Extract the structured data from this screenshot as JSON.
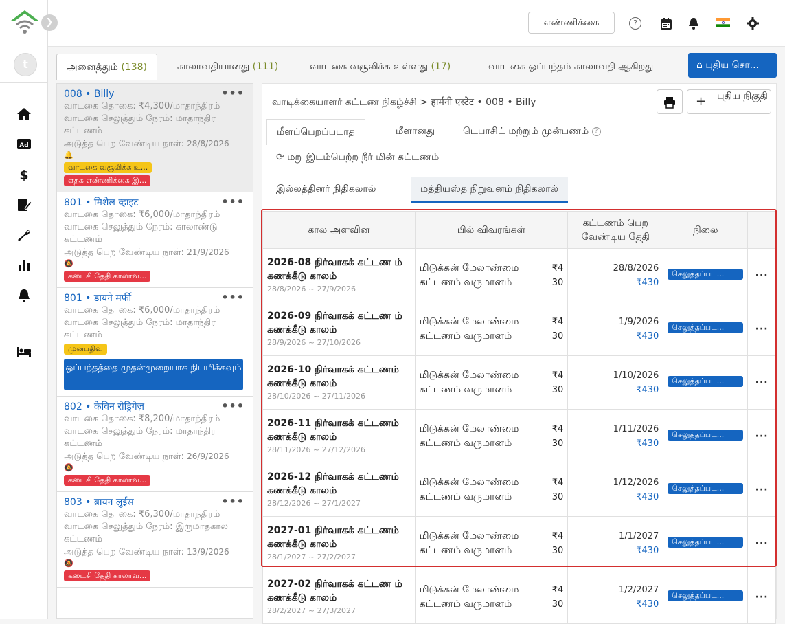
{
  "topbar": {
    "count_label": "எண்ணிக்கை",
    "help_glyph": "?"
  },
  "sidebar": {
    "avatar_initial": "t"
  },
  "tabs": [
    {
      "label": "அனைத்தும்",
      "count": "(138)"
    },
    {
      "label": "காலாவதியானது",
      "count": "(111)"
    },
    {
      "label": "வாடகை வசூலிக்க உள்ளது",
      "count": "(17)"
    },
    {
      "label": "வாடகை ஒப்பந்தம் காலாவதி ஆகிறது",
      "count": ""
    }
  ],
  "new_button": "புதிய சொ...",
  "tenants": [
    {
      "unit": "008",
      "name": "Billy",
      "rent": "வாடகை தொகை: ₹4,300/மாதாந்திரம்",
      "pay": "வாடகை செலுத்தும் நேரம்: மாதாந்திர கட்டணம்",
      "due_label": "அடுத்த பெற வேண்டிய நாள்:",
      "due": "28/8/2026",
      "badges": [
        {
          "text": "வாடகை வசூலிக்க உ...",
          "color": "yellow"
        },
        {
          "text": "ஏதக எண்ணிக்கை இ...",
          "color": "red"
        }
      ]
    },
    {
      "unit": "801",
      "name": "मिशेल व्हाइट",
      "rent": "வாடகை தொகை: ₹6,000/மாதாந்திரம்",
      "pay": "வாடகை செலுத்தும் நேரம்: காலாண்டு கட்டணம்",
      "due_label": "அடுத்த பெற வேண்டிய நாள்:",
      "due": "21/9/2026",
      "badges": [
        {
          "text": "கடைசி தேதி காலாவ...",
          "color": "red"
        }
      ]
    },
    {
      "unit": "801",
      "name": "डायने मर्फी",
      "rent": "வாடகை தொகை: ₹6,000/மாதாந்திரம்",
      "pay": "வாடகை செலுத்தும் நேரம்: மாதாந்திர கட்டணம்",
      "badges": [
        {
          "text": "முன்பதிவு",
          "color": "yellow"
        }
      ],
      "button": "ஒப்பந்தத்தை முதன்முறையாக நியமிக்கவும்"
    },
    {
      "unit": "802",
      "name": "केविन रोड्रिगेज़",
      "rent": "வாடகை தொகை: ₹8,200/மாதாந்திரம்",
      "pay": "வாடகை செலுத்தும் நேரம்: மாதாந்திர கட்டணம்",
      "due_label": "அடுத்த பெற வேண்டிய நாள்:",
      "due": "26/9/2026",
      "badges": [
        {
          "text": "கடைசி தேதி காலாவ...",
          "color": "red"
        }
      ]
    },
    {
      "unit": "803",
      "name": "ब्रायन लुईस",
      "rent": "வாடகை தொகை: ₹6,300/மாதாந்திரம்",
      "pay": "வாடகை செலுத்தும் நேரம்: இருமாதகால கட்டணம்",
      "due_label": "அடுத்த பெற வேண்டிய நாள்:",
      "due": "13/9/2026",
      "badges": [
        {
          "text": "கடைசி தேதி காலாவ...",
          "color": "red"
        }
      ]
    }
  ],
  "detail": {
    "breadcrumb_1": "வாடிக்கையாளர் கட்டண நிகழ்ச்சி",
    "breadcrumb_sep": ">",
    "breadcrumb_2": "हार्मनी एस्टेट • 008 • Billy",
    "new_invoice": "புதிய நிகுதி",
    "subtabs": [
      "மீளப்பெறப்படாத",
      "மீளானது",
      "டெபாசிட் மற்றும் முன்பணம்"
    ],
    "utility": "மறு இடம்பெற்ற நீர் மின் கட்டணம்",
    "role_tabs": [
      "இல்லத்தினர் நிதிகலால்",
      "மத்தியஸ்த நிறுவனம் நிதிகலால்"
    ],
    "columns": [
      "கால அளவின",
      "பில் விவரங்கள்",
      "கட்டணம் பெற வேண்டிய தேதி",
      "நிலை"
    ],
    "rows": [
      {
        "title": "2026-08 நிர்வாகக் கட்டண ம் கணக்கீடு காலம்",
        "range": "28/8/2026 ~ 27/9/2026",
        "desc": "மிடுக்கன் மேலாண்மை கட்டணம் வருமானம்",
        "amt1": "₹4",
        "amt2": "30",
        "due": "28/8/2026",
        "due_amt": "₹430",
        "status": "செலுத்தப்பட..."
      },
      {
        "title": "2026-09 நிர்வாகக் கட்டண ம் கணக்கீடு காலம்",
        "range": "28/9/2026 ~ 27/10/2026",
        "desc": "மிடுக்கன் மேலாண்மை கட்டணம் வருமானம்",
        "amt1": "₹4",
        "amt2": "30",
        "due": "1/9/2026",
        "due_amt": "₹430",
        "status": "செலுத்தப்பட..."
      },
      {
        "title": "2026-10 நிர்வாகக் கட்டணம் கணக்கீடு காலம்",
        "range": "28/10/2026 ~ 27/11/2026",
        "desc": "மிடுக்கன் மேலாண்மை கட்டணம் வருமானம்",
        "amt1": "₹4",
        "amt2": "30",
        "due": "1/10/2026",
        "due_amt": "₹430",
        "status": "செலுத்தப்பட..."
      },
      {
        "title": "2026-11 நிர்வாகக் கட்டணம் கணக்கீடு காலம்",
        "range": "28/11/2026 ~ 27/12/2026",
        "desc": "மிடுக்கன் மேலாண்மை கட்டணம் வருமானம்",
        "amt1": "₹4",
        "amt2": "30",
        "due": "1/11/2026",
        "due_amt": "₹430",
        "status": "செலுத்தப்பட..."
      },
      {
        "title": "2026-12 நிர்வாகக் கட்டணம் கணக்கீடு காலம்",
        "range": "28/12/2026 ~ 27/1/2027",
        "desc": "மிடுக்கன் மேலாண்மை கட்டணம் வருமானம்",
        "amt1": "₹4",
        "amt2": "30",
        "due": "1/12/2026",
        "due_amt": "₹430",
        "status": "செலுத்தப்பட..."
      },
      {
        "title": "2027-01 நிர்வாகக் கட்டணம் கணக்கீடு காலம்",
        "range": "28/1/2027 ~ 27/2/2027",
        "desc": "மிடுக்கன் மேலாண்மை கட்டணம் வருமானம்",
        "amt1": "₹4",
        "amt2": "30",
        "due": "1/1/2027",
        "due_amt": "₹430",
        "status": "செலுத்தப்பட..."
      },
      {
        "title": "2027-02 நிர்வாகக் கட்டண ம் கணக்கீடு காலம்",
        "range": "28/2/2027 ~ 27/3/2027",
        "desc": "மிடுக்கன் மேலாண்மை கட்டணம் வருமானம்",
        "amt1": "₹4",
        "amt2": "30",
        "due": "1/2/2027",
        "due_amt": "₹430",
        "status": "செலுத்தப்பட..."
      }
    ]
  },
  "colors": {
    "primary": "#1565c0",
    "danger": "#e53945",
    "warning": "#f5c518",
    "logo_green": "#4caf50",
    "highlight": "#d32f2f"
  }
}
